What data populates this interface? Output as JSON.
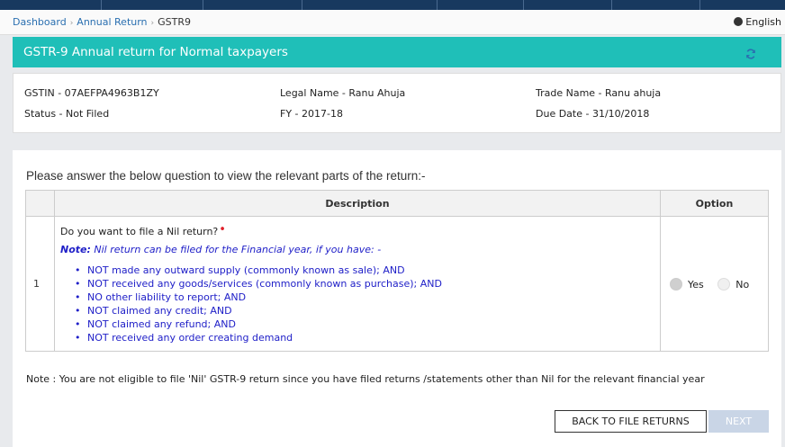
{
  "breadcrumb": {
    "items": [
      "Dashboard",
      "Annual Return"
    ],
    "current": "GSTR9"
  },
  "language": {
    "label": "English",
    "icon": "globe-icon"
  },
  "header": {
    "title": "GSTR-9 Annual return for Normal taxpayers",
    "refresh_icon": "refresh-icon"
  },
  "info": {
    "gstin": "GSTIN - 07AEFPA4963B1ZY",
    "legal_name": "Legal Name - Ranu Ahuja",
    "trade_name": "Trade Name - Ranu ahuja",
    "status": "Status - Not Filed",
    "fy": "FY - 2017-18",
    "due_date": "Due Date - 31/10/2018"
  },
  "question": {
    "title": "Please answer the below question to view the relevant parts of the return:-",
    "columns": {
      "description": "Description",
      "option": "Option"
    },
    "row": {
      "number": "1",
      "text": "Do you want to file a Nil return?",
      "required_mark": "•",
      "note_label": "Note:",
      "note_text": "Nil return can be filed for the Financial year, if you have: -",
      "rules": [
        "NOT made any outward supply (commonly known as sale); AND",
        "NOT received any goods/services (commonly known as purchase); AND",
        "NO other liability to report; AND",
        "NOT claimed any credit; AND",
        "NOT claimed any refund; AND",
        "NOT received any order creating demand"
      ],
      "options": {
        "yes": "Yes",
        "no": "No"
      }
    }
  },
  "footnote": "Note : You are not eligible to file 'Nil' GSTR-9 return since you have filed returns /statements other than Nil for the relevant financial year",
  "buttons": {
    "back": "BACK TO FILE RETURNS",
    "next": "NEXT"
  },
  "colors": {
    "header": "#1fbfb8",
    "topbar": "#18395f",
    "link": "#2a6fb0",
    "note": "#2020c8",
    "next_disabled": "#c9d5e6"
  }
}
